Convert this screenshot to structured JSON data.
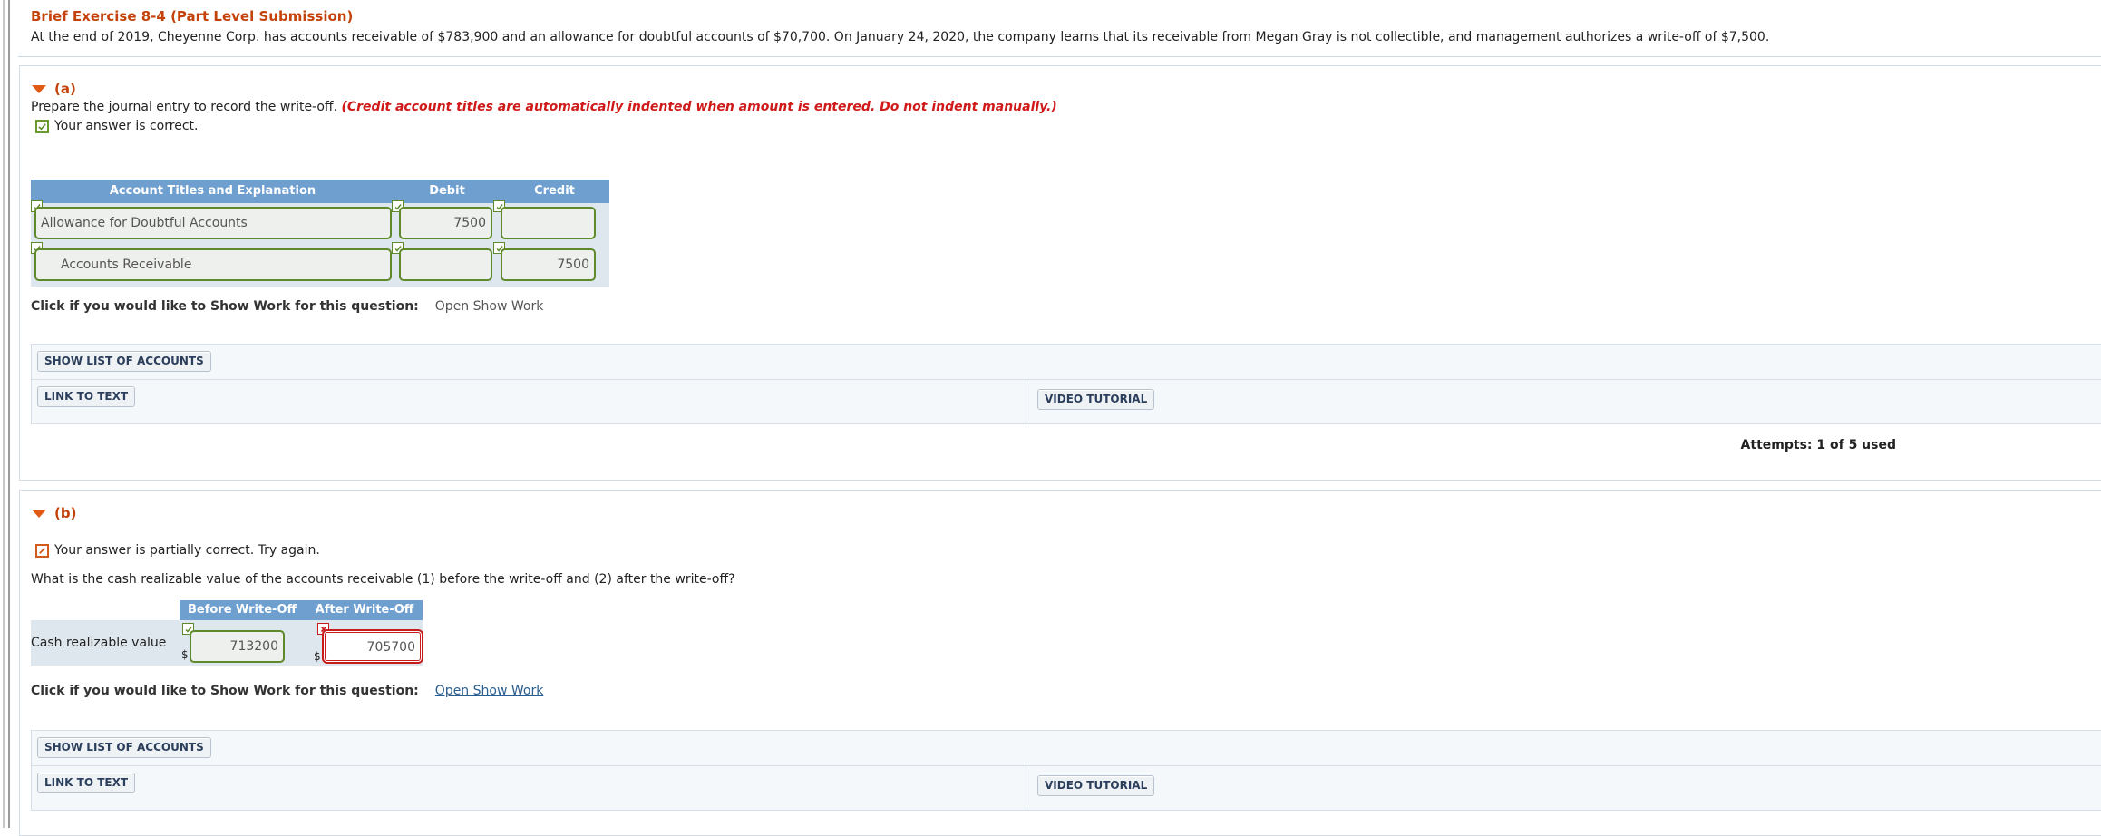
{
  "exercise": {
    "title": "Brief Exercise 8-4 (Part Level Submission)",
    "text": "At the end of 2019, Cheyenne Corp. has accounts receivable of $783,900 and an allowance for doubtful accounts of $70,700. On January 24, 2020, the company learns that its receivable from Megan Gray is not collectible, and management authorizes a write-off of $7,500."
  },
  "part_a": {
    "label": "(a)",
    "status": "Your answer is correct.",
    "prompt": "Prepare the journal entry to record the write-off.",
    "note": "(Credit account titles are automatically indented when amount is entered. Do not indent manually.)",
    "headers": {
      "account": "Account Titles and Explanation",
      "debit": "Debit",
      "credit": "Credit"
    },
    "rows": [
      {
        "account": "Allowance for Doubtful Accounts",
        "debit": "7500",
        "credit": ""
      },
      {
        "account": "Accounts Receivable",
        "debit": "",
        "credit": "7500"
      }
    ],
    "show_work_label": "Click if you would like to Show Work for this question:",
    "show_work_link": "Open Show Work",
    "show_list_btn": "SHOW LIST OF ACCOUNTS",
    "link_text_btn": "LINK TO TEXT",
    "video_btn": "VIDEO TUTORIAL",
    "attempts": "Attempts: 1 of 5 used"
  },
  "part_b": {
    "label": "(b)",
    "status": "Your answer is partially correct.  Try again.",
    "prompt": "What is the cash realizable value of the accounts receivable (1) before the write-off and (2) after the write-off?",
    "headers": {
      "before": "Before Write-Off",
      "after": "After Write-Off"
    },
    "row_label": "Cash realizable value",
    "currency": "$",
    "before_value": "713200",
    "after_value": "705700",
    "show_work_label": "Click if you would like to Show Work for this question:",
    "show_work_link": "Open Show Work",
    "show_list_btn": "SHOW LIST OF ACCOUNTS",
    "link_text_btn": "LINK TO TEXT",
    "video_btn": "VIDEO TUTORIAL"
  }
}
